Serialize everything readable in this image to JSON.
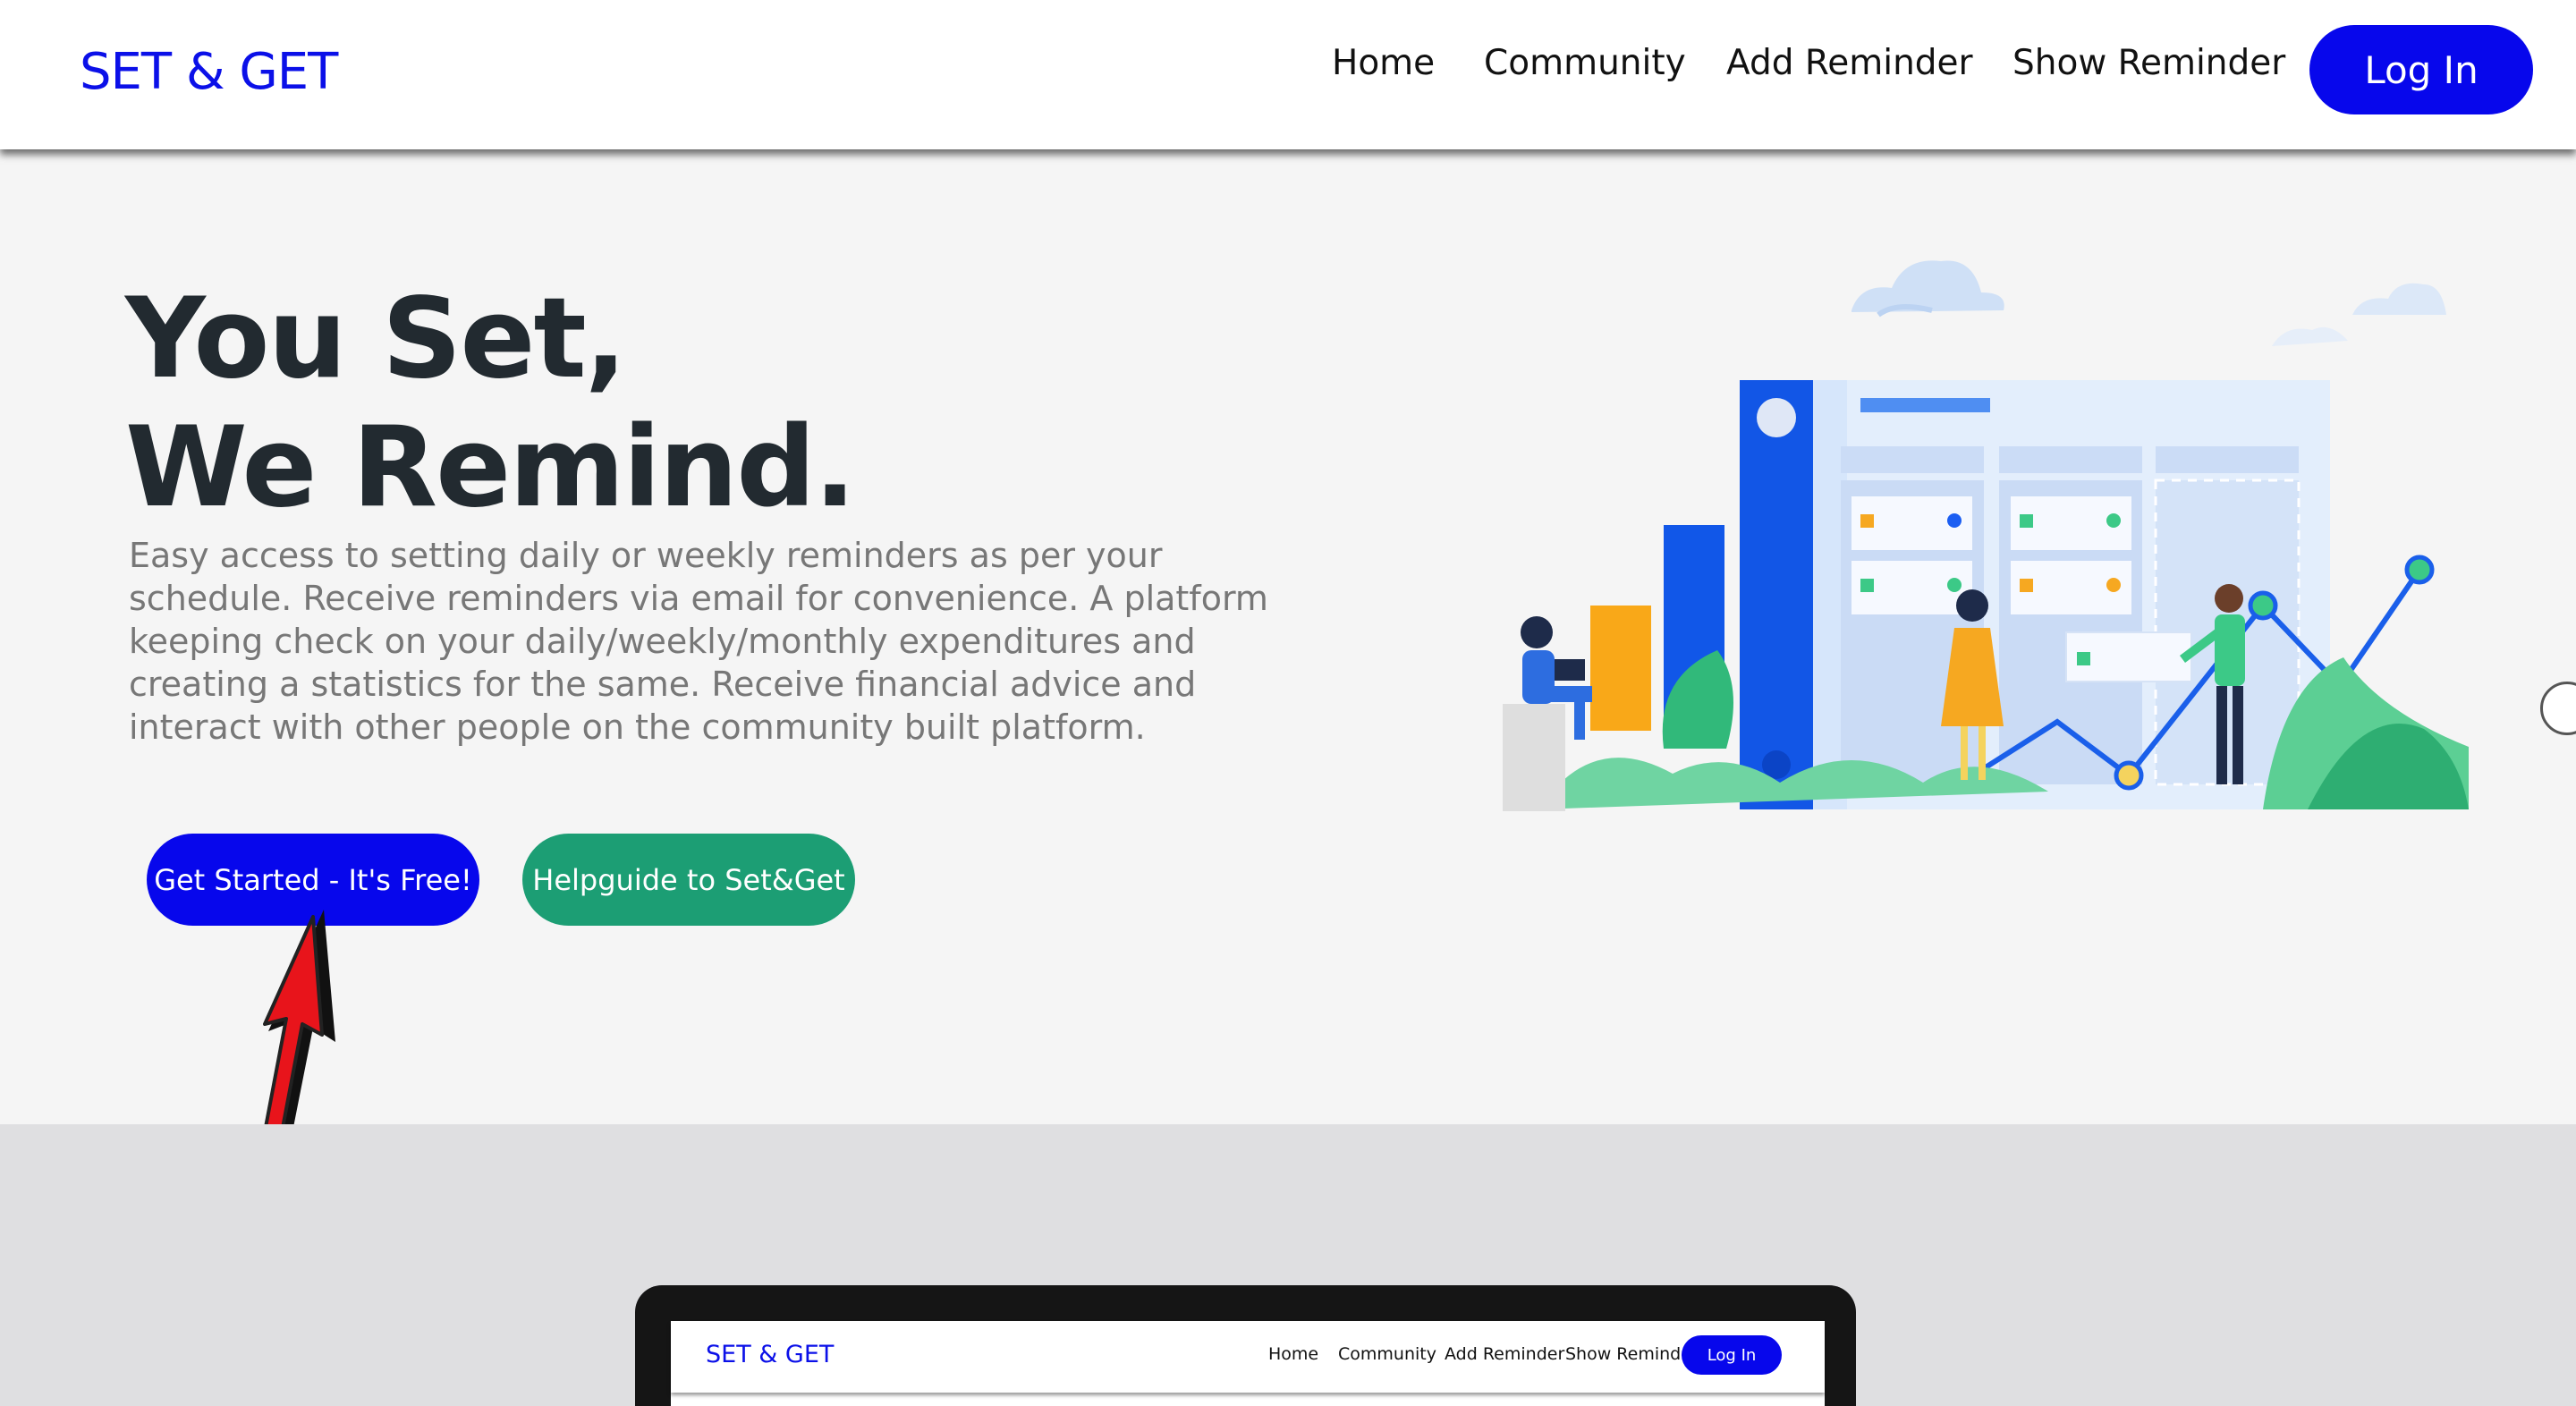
{
  "navbar": {
    "brand": "SET & GET",
    "links": [
      "Home",
      "Community",
      "Add Reminder",
      "Show Reminder"
    ],
    "login_label": "Log In"
  },
  "hero": {
    "title_line1": "You Set,",
    "title_line2": "We Remind.",
    "description": "Easy access to setting daily or weekly reminders as per your schedule. Receive reminders via email for convenience. A platform keeping check on your daily/weekly/monthly expenditures and creating a statistics for the same. Receive financial advice and interact with other people on the community built platform.",
    "get_started_label": "Get Started - It's Free!",
    "helpguide_label": "Helpguide to Set&Get"
  },
  "preview": {
    "brand": "SET & GET",
    "links": [
      "Home",
      "Community",
      "Add Reminder",
      "Show Reminder"
    ],
    "login_label": "Log In"
  },
  "colors": {
    "brand_blue": "#0707ec",
    "help_green": "#1c9e74",
    "arrow_red": "#e8141b"
  },
  "icons": {
    "annotation_arrow": "red-arrow-icon",
    "illustration": "team-dashboard-illustration"
  }
}
